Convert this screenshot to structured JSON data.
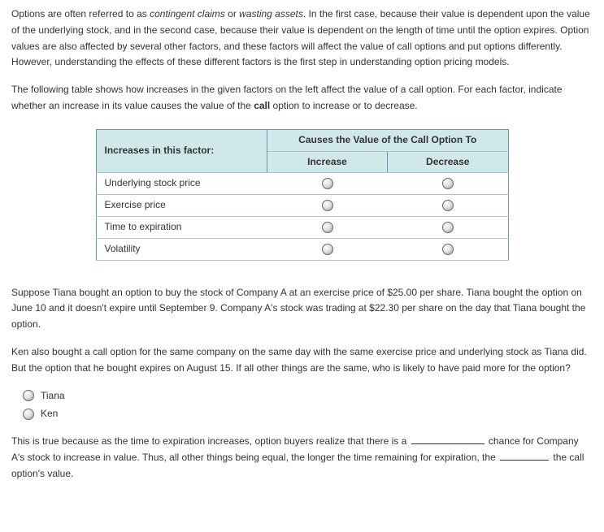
{
  "intro": {
    "seg1": "Options are often referred to as ",
    "em1": "contingent claims",
    "seg2": " or ",
    "em2": "wasting assets",
    "seg3": ". In the first case, because their value is dependent upon the value of the underlying stock, and in the second case, because their value is dependent on the length of time until the option expires. Option values are also affected by several other factors, and these factors will affect the value of call options and put options differently. However, understanding the effects of these different factors is the first step in understanding option pricing models."
  },
  "lead": {
    "seg1": "The following table shows how increases in the given factors on the left affect the value of a call option. For each factor, indicate whether an increase in its value causes the value of the ",
    "bold": "call",
    "seg2": " option to increase or to decrease."
  },
  "table": {
    "col_factor": "Increases in this factor:",
    "col_span": "Causes the Value of the Call Option To",
    "col_inc": "Increase",
    "col_dec": "Decrease",
    "rows": [
      {
        "label": "Underlying stock price"
      },
      {
        "label": "Exercise price"
      },
      {
        "label": "Time to expiration"
      },
      {
        "label": "Volatility"
      }
    ]
  },
  "scenario1": "Suppose Tiana bought an option to buy the stock of Company A at an exercise price of $25.00 per share. Tiana bought the option on June 10 and it doesn't expire until September 9. Company A's stock was trading at $22.30 per share on the day that Tiana bought the option.",
  "scenario2": "Ken also bought a call option for the same company on the same day with the same exercise price and underlying stock as Tiana did. But the option that he bought expires on August 15. If all other things are the same, who is likely to have paid more for the option?",
  "choices": [
    "Tiana",
    "Ken"
  ],
  "closing": {
    "seg1": "This is true because as the time to expiration increases, option buyers realize that there is a ",
    "seg2": " chance for Company A's stock to increase in value. Thus, all other things being equal, the longer the time remaining for expiration, the ",
    "seg3": " the call option's value."
  }
}
